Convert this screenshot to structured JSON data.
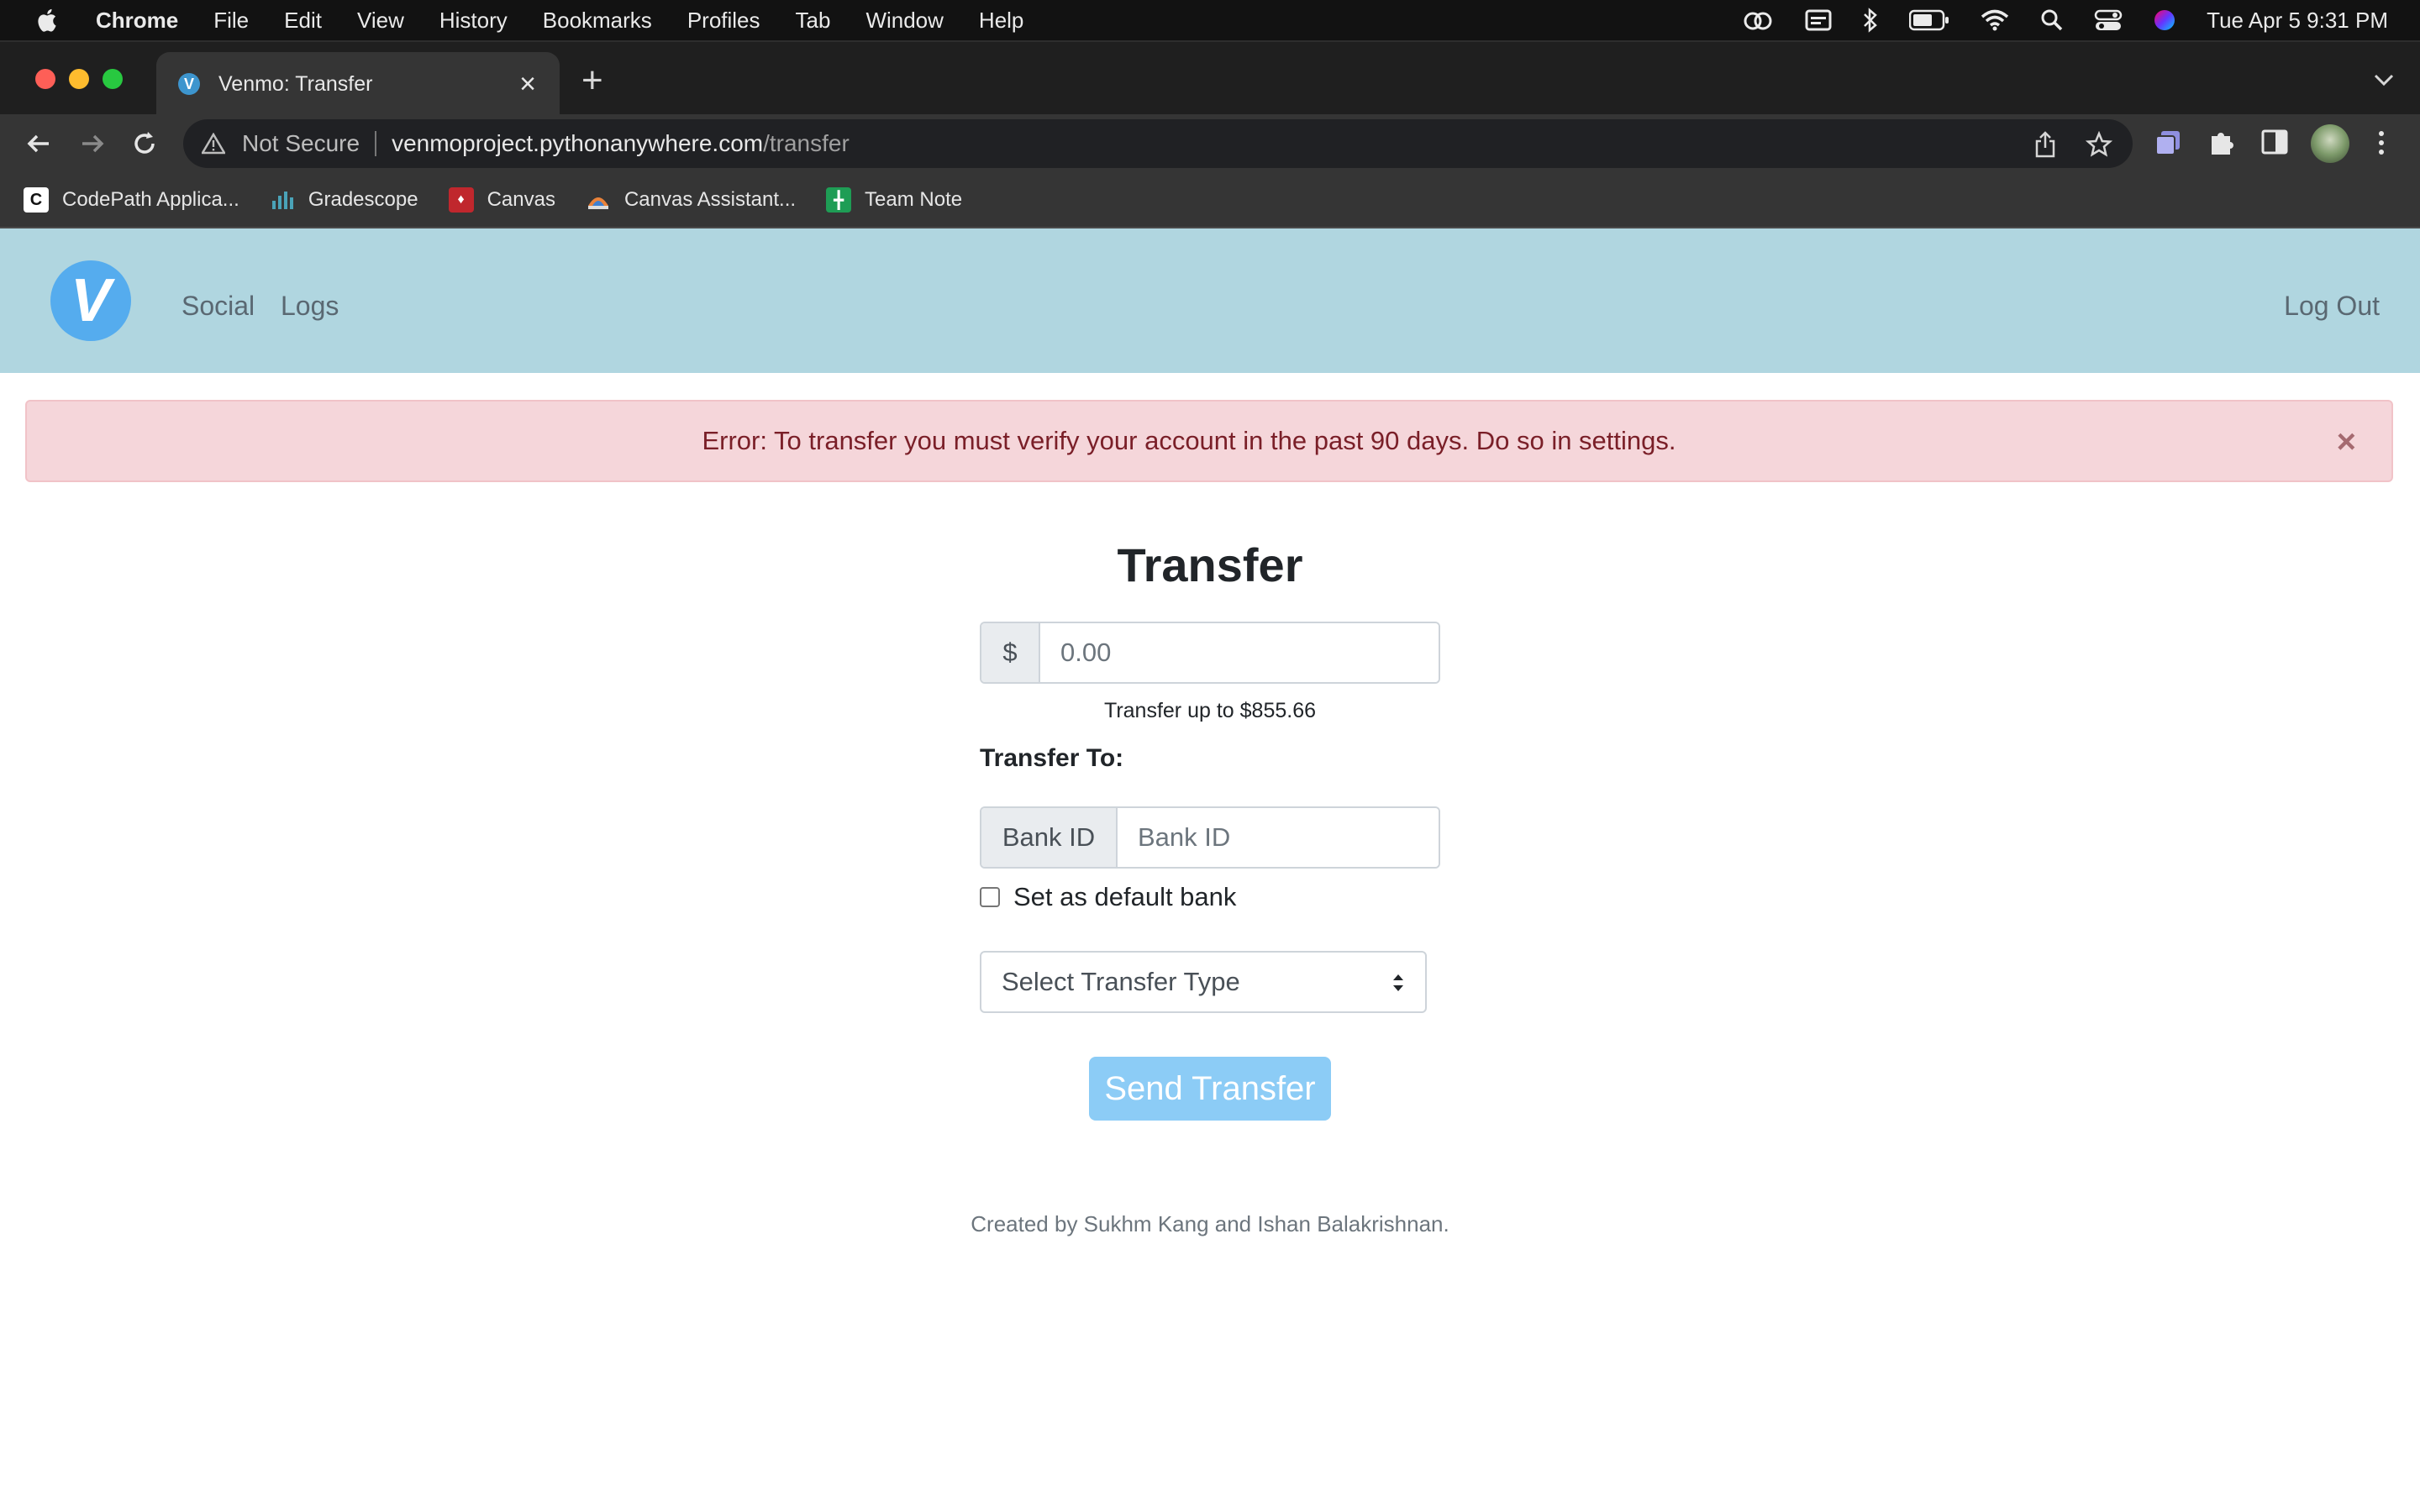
{
  "menubar": {
    "app_name": "Chrome",
    "items": [
      "File",
      "Edit",
      "View",
      "History",
      "Bookmarks",
      "Profiles",
      "Tab",
      "Window",
      "Help"
    ],
    "clock": "Tue Apr 5  9:31 PM",
    "status_icons": [
      "creative-cloud-icon",
      "calendar-icon",
      "bluetooth-icon",
      "battery-icon",
      "wifi-icon",
      "spotlight-icon",
      "control-center-icon",
      "siri-icon"
    ]
  },
  "browser": {
    "tab_title": "Venmo: Transfer",
    "url_security": "Not Secure",
    "url_host": "venmoproject.pythonanywhere.com",
    "url_path": "/transfer",
    "bookmarks": [
      "CodePath Applica...",
      "Gradescope",
      "Canvas",
      "Canvas Assistant...",
      "Team Note"
    ]
  },
  "navbar": {
    "logo_letter": "V",
    "links": {
      "social": "Social",
      "logs": "Logs",
      "logout": "Log Out"
    }
  },
  "alert": {
    "message": "Error: To transfer you must verify your account in the past 90 days. Do so in settings.",
    "close_glyph": "×"
  },
  "form": {
    "title": "Transfer",
    "currency_symbol": "$",
    "amount_placeholder": "0.00",
    "limit_hint": "Transfer up to $855.66",
    "transfer_to_label": "Transfer To:",
    "bank_addon": "Bank ID",
    "bank_placeholder": "Bank ID",
    "default_bank_label": "Set as default bank",
    "default_bank_checked": false,
    "transfer_type_selected": "Select Transfer Type",
    "submit_label": "Send Transfer"
  },
  "footer": {
    "credits": "Created by Sukhm Kang and Ishan Balakrishnan."
  },
  "colors": {
    "navbar_bg": "#b0d6e0",
    "alert_bg": "#f5d6da",
    "alert_text": "#7a1f28",
    "button_bg": "#8cccf6",
    "logo_bg": "#55acee"
  }
}
